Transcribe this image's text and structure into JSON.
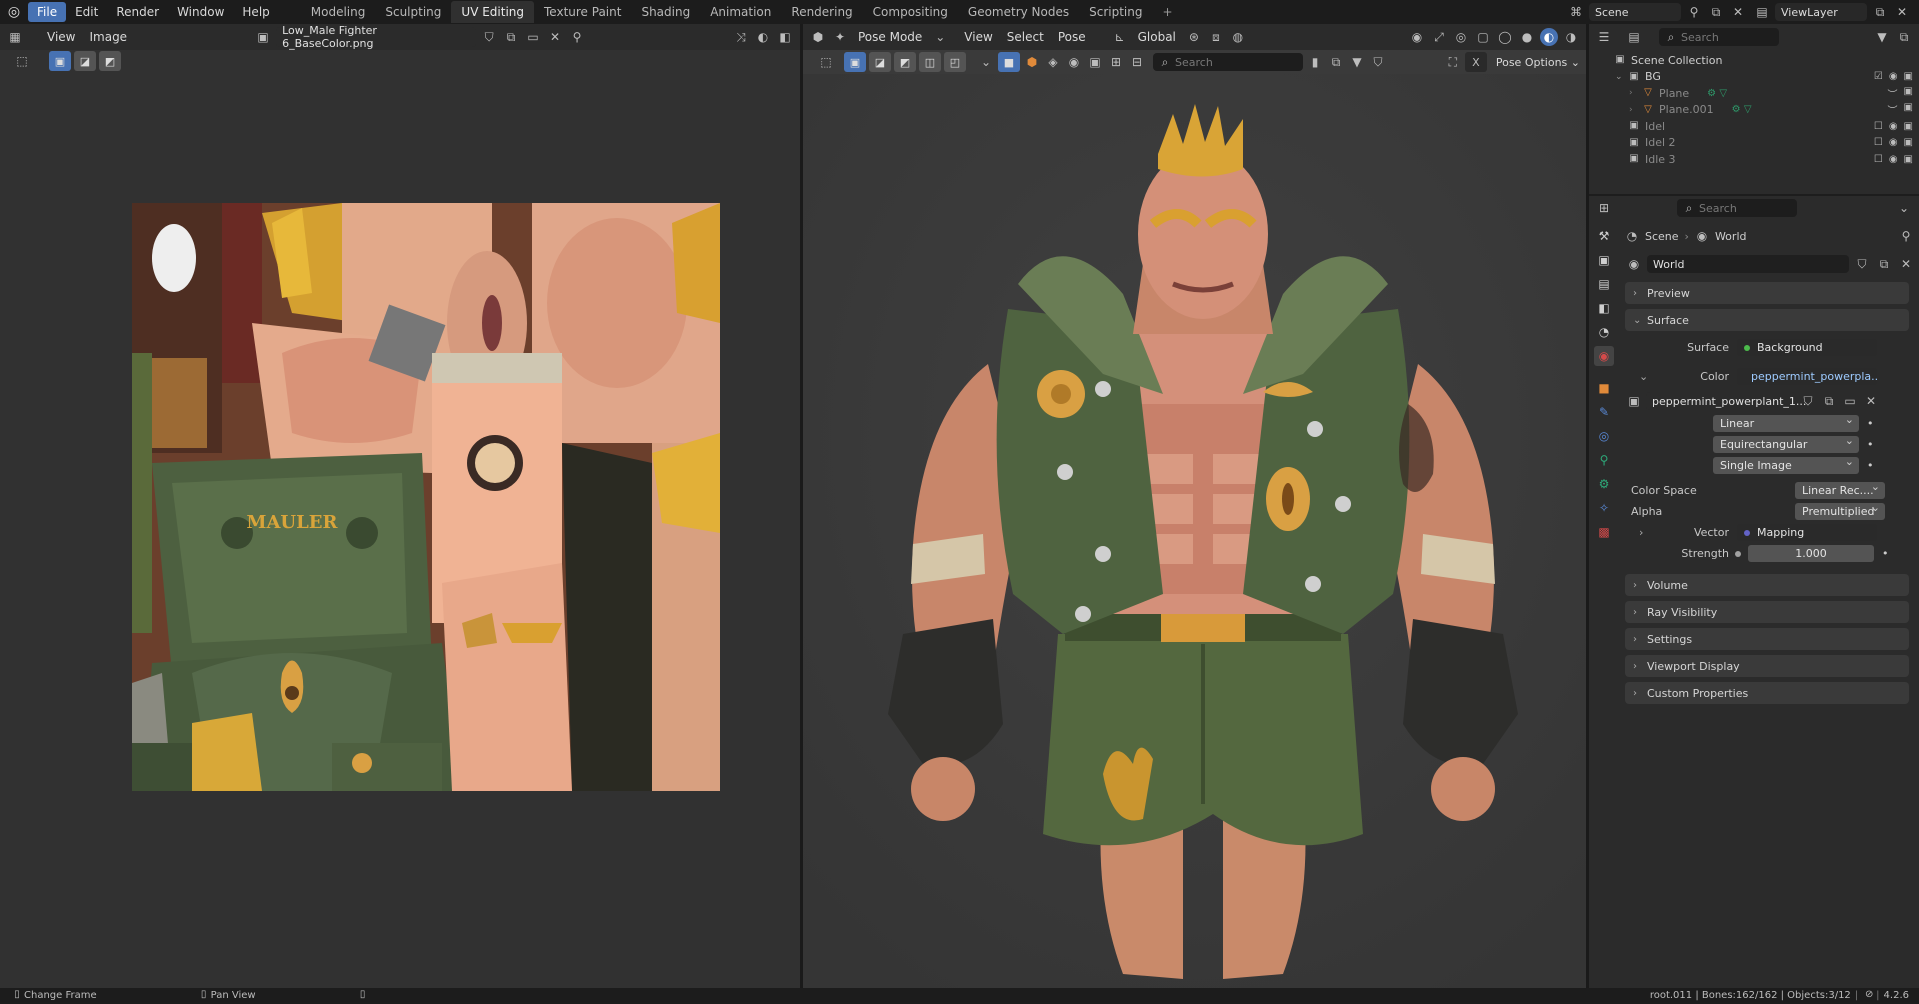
{
  "topbar": {
    "menu": [
      "File",
      "Edit",
      "Render",
      "Window",
      "Help"
    ],
    "workspaces": [
      "Modeling",
      "Sculpting",
      "UV Editing",
      "Texture Paint",
      "Shading",
      "Animation",
      "Rendering",
      "Compositing",
      "Geometry Nodes",
      "Scripting"
    ],
    "active_workspace": "UV Editing",
    "scene_label": "Scene",
    "viewlayer_label": "ViewLayer"
  },
  "uv_editor": {
    "header_menus": [
      "View",
      "Image"
    ],
    "image_name": "Low_Male Fighter 6_BaseColor.png",
    "texture_text": "MAULER"
  },
  "viewport": {
    "mode": "Pose Mode",
    "menus": [
      "View",
      "Select",
      "Pose"
    ],
    "orientation": "Global",
    "search_placeholder": "Search",
    "options_label": "Pose Options"
  },
  "outliner": {
    "search_placeholder": "Search",
    "root": "Scene Collection",
    "items": [
      {
        "name": "BG",
        "type": "collection",
        "indent": 1
      },
      {
        "name": "Plane",
        "type": "mesh",
        "indent": 2
      },
      {
        "name": "Plane.001",
        "type": "mesh",
        "indent": 2
      },
      {
        "name": "Idel",
        "type": "collection",
        "indent": 1
      },
      {
        "name": "Idel 2",
        "type": "collection",
        "indent": 1
      },
      {
        "name": "Idle 3",
        "type": "collection",
        "indent": 1
      }
    ]
  },
  "properties": {
    "search_placeholder": "Search",
    "breadcrumb": [
      "Scene",
      "World"
    ],
    "world_name": "World",
    "sections": {
      "preview": "Preview",
      "surface": "Surface",
      "volume": "Volume",
      "ray_visibility": "Ray Visibility",
      "settings": "Settings",
      "viewport_display": "Viewport Display",
      "custom_properties": "Custom Properties"
    },
    "surface_label": "Surface",
    "surface_value": "Background",
    "color_label": "Color",
    "color_value": "peppermint_powerpla...",
    "image_name": "peppermint_powerplant_1...",
    "interpolation": "Linear",
    "projection": "Equirectangular",
    "source": "Single Image",
    "color_space_label": "Color Space",
    "color_space_value": "Linear Rec....",
    "alpha_label": "Alpha",
    "alpha_value": "Premultiplied",
    "vector_label": "Vector",
    "vector_value": "Mapping",
    "strength_label": "Strength",
    "strength_value": "1.000"
  },
  "statusbar": {
    "left1": "Change Frame",
    "left2": "Pan View",
    "right": "root.011 | Bones:162/162 | Objects:3/12",
    "version": "4.2.6"
  },
  "colors": {
    "accent": "#4772b3",
    "surface_socket": "#4cbb4c",
    "color_socket": "#c7c729",
    "vector_socket": "#6363c7",
    "float_socket": "#a1a1a1"
  }
}
